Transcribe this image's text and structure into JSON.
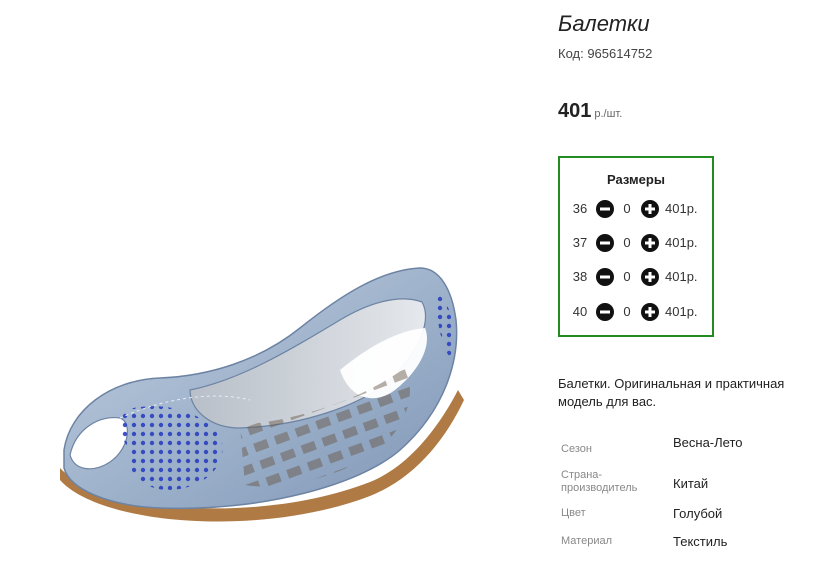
{
  "product": {
    "title": "Балетки",
    "code": "Код: 965614752",
    "price": "401",
    "price_unit": "р./шт.",
    "image_icon": "shoe-photo"
  },
  "sizes": {
    "title": "Размеры",
    "rows": [
      {
        "size": "36",
        "qty": "0",
        "price": "401р."
      },
      {
        "size": "37",
        "qty": "0",
        "price": "401р."
      },
      {
        "size": "38",
        "qty": "0",
        "price": "401р."
      },
      {
        "size": "40",
        "qty": "0",
        "price": "401р."
      }
    ],
    "minus_icon": "minus-circle-icon",
    "plus_icon": "plus-circle-icon"
  },
  "description": "Балетки. Оригинальная и практичная модель для вас.",
  "attributes": [
    {
      "label": "Сезон",
      "value": "Весна-Лето"
    },
    {
      "label": "Страна-производитель",
      "value": "Китай"
    },
    {
      "label": "Цвет",
      "value": "Голубой"
    },
    {
      "label": "Материал",
      "value": "Текстиль"
    }
  ],
  "colors": {
    "box_border": "#228b22",
    "shoe_denim": "#9fb3cc",
    "rhinestone": "#2a3fbf"
  }
}
